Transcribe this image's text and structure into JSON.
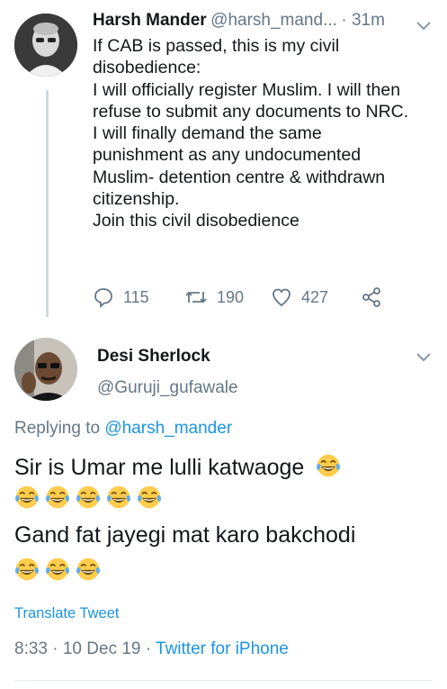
{
  "original_tweet": {
    "display_name": "Harsh Mander",
    "handle": "@harsh_mand...",
    "time": "· 31m",
    "lines": [
      "If CAB is passed, this is my civil",
      "disobedience:",
      "I will officially register Muslim. I will then",
      "refuse to submit any documents to NRC.",
      "I will finally demand the same",
      "punishment as any undocumented",
      "Muslim- detention centre & withdrawn",
      "citizenship.",
      "Join this civil disobedience"
    ],
    "reply_count": "115",
    "retweet_count": "190",
    "like_count": "427",
    "icons": [
      "reply-icon",
      "retweet-icon",
      "like-icon",
      "share-icon",
      "chevron-down-icon"
    ]
  },
  "reply_tweet": {
    "display_name": "Desi Sherlock",
    "handle": "@Guruji_gufawale",
    "replying_prefix": "Replying to ",
    "replying_to": "@harsh_mander",
    "line1": "Sir is Umar me lulli katwaoge",
    "line2": "Gand fat jayegi mat karo bakchodi",
    "emoji": "face-with-tears-of-joy",
    "translate_label": "Translate Tweet",
    "timestamp": "8:33 · 10 Dec 19 · ",
    "client": "Twitter for iPhone"
  },
  "colors": {
    "link": "#1b95e0",
    "muted": "#657786",
    "text": "#14171a"
  }
}
